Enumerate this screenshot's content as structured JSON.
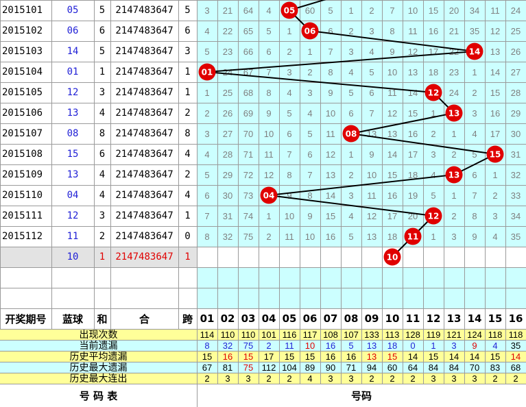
{
  "colors": {
    "cyan_bg": "#ccffff",
    "yellow_bg": "#ffff99",
    "gray_bg": "#e3e3e3",
    "ball_red": "#e00000",
    "blue_text": "#1f1fd6",
    "red_text": "#e00000",
    "miss_text": "#7f7f7f"
  },
  "rows": [
    {
      "period": "2015101",
      "blue": "05",
      "sum": "5",
      "id": "2147483647",
      "span": "5",
      "miss": [
        "3",
        "21",
        "64",
        "4",
        "05",
        "60",
        "5",
        "1",
        "2",
        "7",
        "10",
        "15",
        "20",
        "34",
        "11",
        "24"
      ],
      "ball": 5
    },
    {
      "period": "2015102",
      "blue": "06",
      "sum": "6",
      "id": "2147483647",
      "span": "6",
      "miss": [
        "4",
        "22",
        "65",
        "5",
        "1",
        "06",
        "6",
        "2",
        "3",
        "8",
        "11",
        "16",
        "21",
        "35",
        "12",
        "25"
      ],
      "ball": 6
    },
    {
      "period": "2015103",
      "blue": "14",
      "sum": "5",
      "id": "2147483647",
      "span": "3",
      "miss": [
        "5",
        "23",
        "66",
        "6",
        "2",
        "1",
        "7",
        "3",
        "4",
        "9",
        "12",
        "17",
        "22",
        "14",
        "13",
        "26"
      ],
      "ball": 14
    },
    {
      "period": "2015104",
      "blue": "01",
      "sum": "1",
      "id": "2147483647",
      "span": "1",
      "miss": [
        "01",
        "24",
        "67",
        "7",
        "3",
        "2",
        "8",
        "4",
        "5",
        "10",
        "13",
        "18",
        "23",
        "1",
        "14",
        "27"
      ],
      "ball": 1
    },
    {
      "period": "2015105",
      "blue": "12",
      "sum": "3",
      "id": "2147483647",
      "span": "1",
      "miss": [
        "1",
        "25",
        "68",
        "8",
        "4",
        "3",
        "9",
        "5",
        "6",
        "11",
        "14",
        "12",
        "24",
        "2",
        "15",
        "28"
      ],
      "ball": 12
    },
    {
      "period": "2015106",
      "blue": "13",
      "sum": "4",
      "id": "2147483647",
      "span": "2",
      "miss": [
        "2",
        "26",
        "69",
        "9",
        "5",
        "4",
        "10",
        "6",
        "7",
        "12",
        "15",
        "1",
        "13",
        "3",
        "16",
        "29"
      ],
      "ball": 13
    },
    {
      "period": "2015107",
      "blue": "08",
      "sum": "8",
      "id": "2147483647",
      "span": "8",
      "miss": [
        "3",
        "27",
        "70",
        "10",
        "6",
        "5",
        "11",
        "08",
        "13",
        "13",
        "16",
        "2",
        "1",
        "4",
        "17",
        "30"
      ],
      "ball": 8
    },
    {
      "period": "2015108",
      "blue": "15",
      "sum": "6",
      "id": "2147483647",
      "span": "4",
      "miss": [
        "4",
        "28",
        "71",
        "11",
        "7",
        "6",
        "12",
        "1",
        "9",
        "14",
        "17",
        "3",
        "2",
        "5",
        "15",
        "31"
      ],
      "ball": 15
    },
    {
      "period": "2015109",
      "blue": "13",
      "sum": "4",
      "id": "2147483647",
      "span": "2",
      "miss": [
        "5",
        "29",
        "72",
        "12",
        "8",
        "7",
        "13",
        "2",
        "10",
        "15",
        "18",
        "4",
        "13",
        "6",
        "1",
        "32"
      ],
      "ball": 13
    },
    {
      "period": "2015110",
      "blue": "04",
      "sum": "4",
      "id": "2147483647",
      "span": "4",
      "miss": [
        "6",
        "30",
        "73",
        "04",
        "9",
        "8",
        "14",
        "3",
        "11",
        "16",
        "19",
        "5",
        "1",
        "7",
        "2",
        "33"
      ],
      "ball": 4
    },
    {
      "period": "2015111",
      "blue": "12",
      "sum": "3",
      "id": "2147483647",
      "span": "1",
      "miss": [
        "7",
        "31",
        "74",
        "1",
        "10",
        "9",
        "15",
        "4",
        "12",
        "17",
        "20",
        "12",
        "2",
        "8",
        "3",
        "34"
      ],
      "ball": 12
    },
    {
      "period": "2015112",
      "blue": "11",
      "sum": "2",
      "id": "2147483647",
      "span": "0",
      "miss": [
        "8",
        "32",
        "75",
        "2",
        "11",
        "10",
        "16",
        "5",
        "13",
        "18",
        "11",
        "1",
        "3",
        "9",
        "4",
        "35"
      ],
      "ball": 11
    }
  ],
  "forecast": {
    "blue": "10",
    "sum": "1",
    "id": "2147483647",
    "span": "1",
    "ball": 10
  },
  "header": {
    "period": "开奖期号",
    "blue": "蓝球",
    "sum": "和",
    "id": "合",
    "span": "跨",
    "numbers": [
      "01",
      "02",
      "03",
      "04",
      "05",
      "06",
      "07",
      "08",
      "09",
      "10",
      "11",
      "12",
      "13",
      "14",
      "15",
      "16"
    ]
  },
  "stats": [
    {
      "label": "出现次数",
      "values": [
        "114",
        "110",
        "110",
        "101",
        "116",
        "117",
        "108",
        "107",
        "133",
        "113",
        "128",
        "119",
        "121",
        "124",
        "118",
        "118"
      ]
    },
    {
      "label": "当前遗漏",
      "values": [
        "8",
        "32",
        "75",
        "2",
        "11",
        "10",
        "16",
        "5",
        "13",
        "18",
        "0",
        "1",
        "3",
        "9",
        "4",
        "35"
      ]
    },
    {
      "label": "历史平均遗漏",
      "values": [
        "15",
        "16",
        "15",
        "17",
        "15",
        "15",
        "16",
        "16",
        "13",
        "15",
        "14",
        "15",
        "14",
        "14",
        "15",
        "14"
      ]
    },
    {
      "label": "历史最大遗漏",
      "values": [
        "67",
        "81",
        "75",
        "112",
        "104",
        "89",
        "90",
        "71",
        "94",
        "60",
        "64",
        "84",
        "84",
        "70",
        "83",
        "68"
      ]
    },
    {
      "label": "历史最大连出",
      "values": [
        "2",
        "3",
        "3",
        "2",
        "2",
        "4",
        "3",
        "3",
        "2",
        "2",
        "2",
        "3",
        "3",
        "3",
        "2",
        "2"
      ]
    }
  ],
  "footer": {
    "left": "号 码 表",
    "right": "号码"
  }
}
